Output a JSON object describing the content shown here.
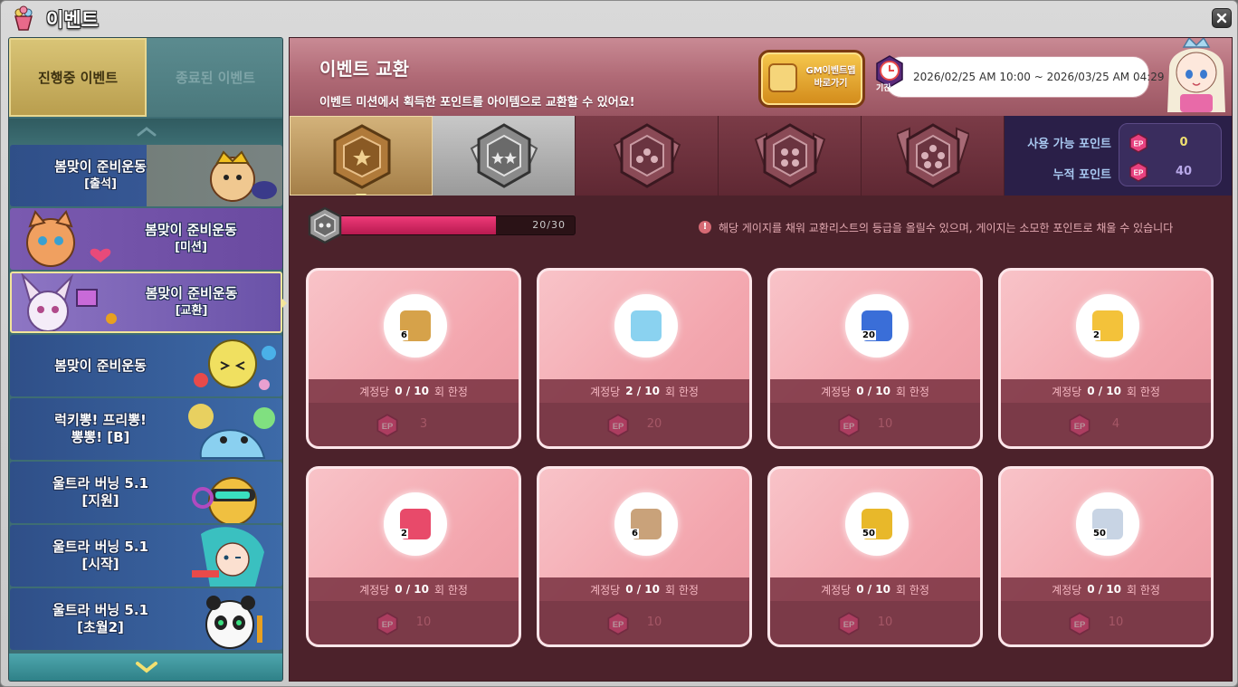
{
  "window": {
    "title": "이벤트"
  },
  "sidebar": {
    "tabs": [
      {
        "label": "진행중 이벤트",
        "active": true
      },
      {
        "label": "종료된 이벤트",
        "active": false
      }
    ],
    "events": [
      {
        "title": "봄맞이 준비운동",
        "sub": "[출석]",
        "bg": "#2e4f86"
      },
      {
        "title": "봄맞이 준비운동",
        "sub": "[미션]",
        "bg": "#6a4ea0"
      },
      {
        "title": "봄맞이 준비운동",
        "sub": "[교환]",
        "bg": "#6a4ea0",
        "selected": true
      },
      {
        "title": "봄맞이 준비운동",
        "sub": "",
        "bg": "#2e4f86"
      },
      {
        "title": "럭키뽕! 프리뽕!",
        "sub": "뽕뽕! [B]",
        "bg": "#2e4f86"
      },
      {
        "title": "울트라 버닝 5.1",
        "sub": "[지원]",
        "bg": "#2e4f86"
      },
      {
        "title": "울트라 버닝 5.1",
        "sub": "[시작]",
        "bg": "#2e4f86"
      },
      {
        "title": "울트라 버닝 5.1",
        "sub": "[초월2]",
        "bg": "#2e4f86"
      }
    ]
  },
  "header": {
    "title": "이벤트 교환",
    "description": "이벤트 미션에서 획득한 포인트를 아이템으로 교환할 수 있어요!",
    "gm_button": {
      "line1": "GM이벤트맵",
      "line2": "바로가기"
    },
    "period_label": "기간",
    "period": "2026/02/25 AM 10:00 ~ 2026/03/25 AM 04:29"
  },
  "points": {
    "available_label": "사용 가능 포인트",
    "available_value": "0",
    "total_label": "누적 포인트",
    "total_value": "40"
  },
  "gauge": {
    "text": "20/30",
    "progress": 0.6667,
    "notice": "해당 게이지를 채워 교환리스트의 등급을 올릴수 있으며, 게이지는 소모한 포인트로 채울 수 있습니다"
  },
  "colors": {
    "accent": "#ee3a78",
    "point_icon": "#e8417f"
  },
  "items": [
    {
      "icon": "crystal-icon",
      "color": "#d6a24a",
      "qty": "6",
      "per": "계정당",
      "count": "0 / 10",
      "unit": "회 한정",
      "cost": "3"
    },
    {
      "icon": "potion-icon",
      "color": "#8ad2f0",
      "qty": "",
      "per": "계정당",
      "count": "2 / 10",
      "unit": "회 한정",
      "cost": "20"
    },
    {
      "icon": "scroll-icon",
      "color": "#3a6ed8",
      "qty": "20",
      "per": "계정당",
      "count": "0 / 10",
      "unit": "회 한정",
      "cost": "10"
    },
    {
      "icon": "elixir-icon",
      "color": "#f3c23a",
      "qty": "2",
      "per": "계정당",
      "count": "0 / 10",
      "unit": "회 한정",
      "cost": "4"
    },
    {
      "icon": "heart-potion-icon",
      "color": "#e84a6a",
      "qty": "2",
      "per": "계정당",
      "count": "0 / 10",
      "unit": "회 한정",
      "cost": "10"
    },
    {
      "icon": "map-icon",
      "color": "#c9a27a",
      "qty": "6",
      "per": "계정당",
      "count": "0 / 10",
      "unit": "회 한정",
      "cost": "10"
    },
    {
      "icon": "coin-icon",
      "color": "#e8b82a",
      "qty": "50",
      "per": "계정당",
      "count": "0 / 10",
      "unit": "회 한정",
      "cost": "10"
    },
    {
      "icon": "silver-coin-icon",
      "color": "#c8d4e4",
      "qty": "50",
      "per": "계정당",
      "count": "0 / 10",
      "unit": "회 한정",
      "cost": "10"
    }
  ]
}
